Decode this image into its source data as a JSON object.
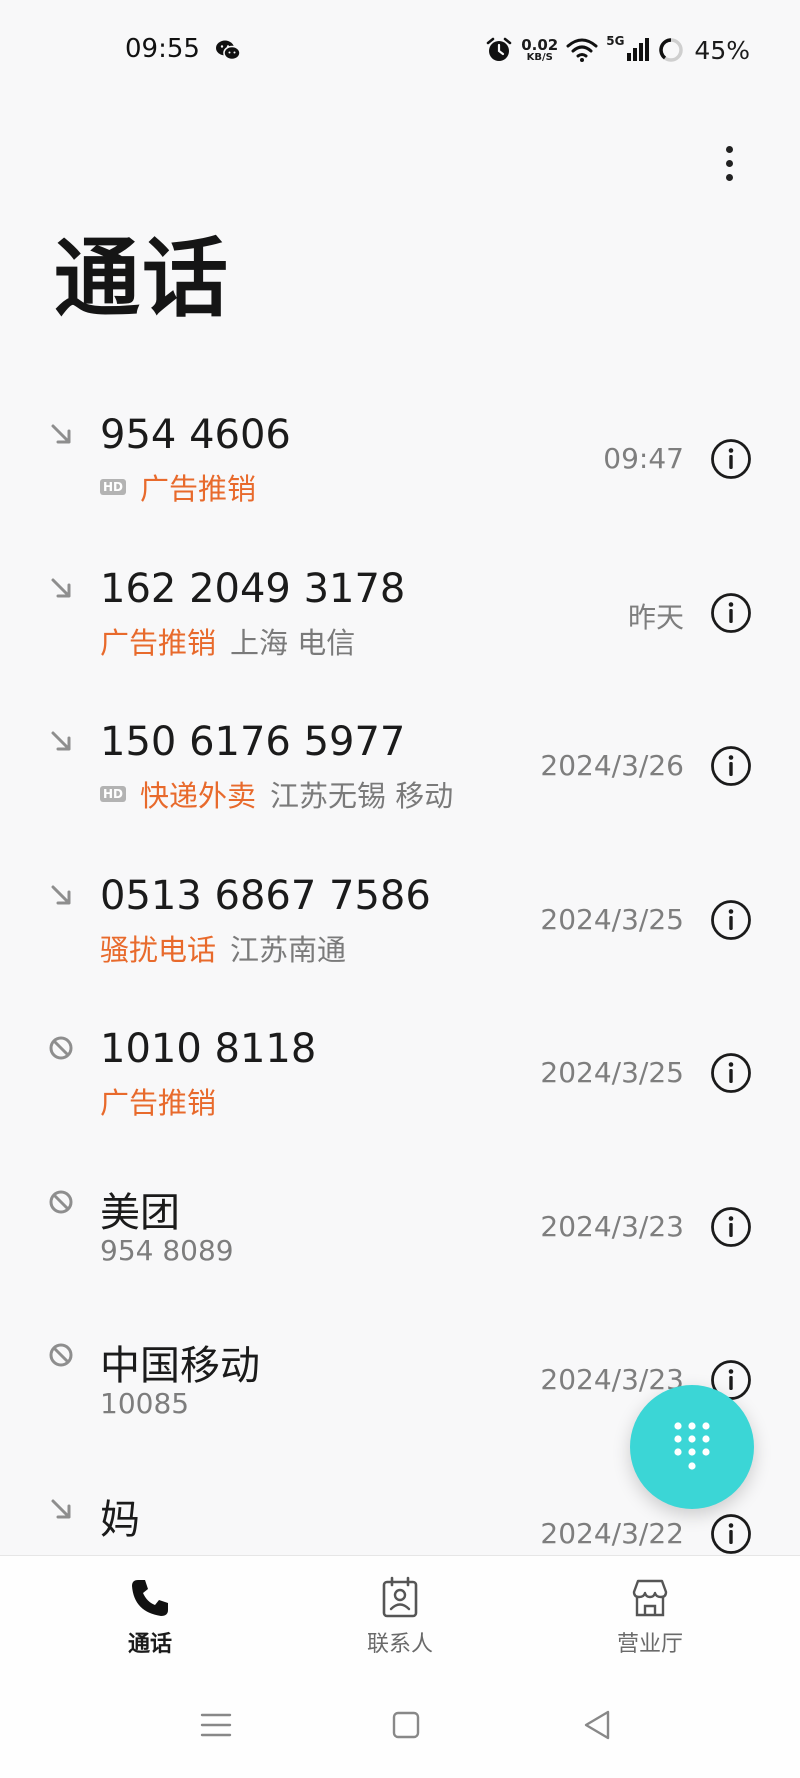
{
  "status_bar": {
    "time": "09:55",
    "net_speed_value": "0.02",
    "net_speed_unit": "KB/S",
    "network_type": "5G",
    "battery": "45%"
  },
  "header": {
    "title": "通话"
  },
  "calls": [
    {
      "type_icon": "incoming-call-icon",
      "name": "954 4606",
      "hd": true,
      "hd_label": "HD",
      "tag": "广告推销",
      "location": "",
      "number": "",
      "time": "09:47"
    },
    {
      "type_icon": "incoming-call-icon",
      "name": "162 2049 3178",
      "hd": false,
      "hd_label": "",
      "tag": "广告推销",
      "location": "上海 电信",
      "number": "",
      "time": "昨天"
    },
    {
      "type_icon": "incoming-call-icon",
      "name": "150 6176 5977",
      "hd": true,
      "hd_label": "HD",
      "tag": "快递外卖",
      "location": "江苏无锡 移动",
      "number": "",
      "time": "2024/3/26"
    },
    {
      "type_icon": "incoming-call-icon",
      "name": "0513 6867 7586",
      "hd": false,
      "hd_label": "",
      "tag": "骚扰电话",
      "location": "江苏南通",
      "number": "",
      "time": "2024/3/25"
    },
    {
      "type_icon": "blocked-call-icon",
      "name": "1010 8118",
      "hd": false,
      "hd_label": "",
      "tag": "广告推销",
      "location": "",
      "number": "",
      "time": "2024/3/25"
    },
    {
      "type_icon": "blocked-call-icon",
      "name": "美团",
      "hd": false,
      "hd_label": "",
      "tag": "",
      "location": "",
      "number": "954 8089",
      "time": "2024/3/23"
    },
    {
      "type_icon": "blocked-call-icon",
      "name": "中国移动",
      "hd": false,
      "hd_label": "",
      "tag": "",
      "location": "",
      "number": "10085",
      "time": "2024/3/23"
    },
    {
      "type_icon": "incoming-call-icon",
      "name": "妈",
      "hd": false,
      "hd_label": "",
      "tag": "",
      "location": "",
      "number": "",
      "time": "2024/3/22"
    }
  ],
  "tabs": [
    {
      "label": "通话",
      "icon": "phone-icon",
      "active": true
    },
    {
      "label": "联系人",
      "icon": "contacts-icon",
      "active": false
    },
    {
      "label": "营业厅",
      "icon": "store-icon",
      "active": false
    }
  ],
  "colors": {
    "accent_fab": "#3bd6d6",
    "tag": "#e86a2c",
    "background": "#f8f8f9"
  }
}
